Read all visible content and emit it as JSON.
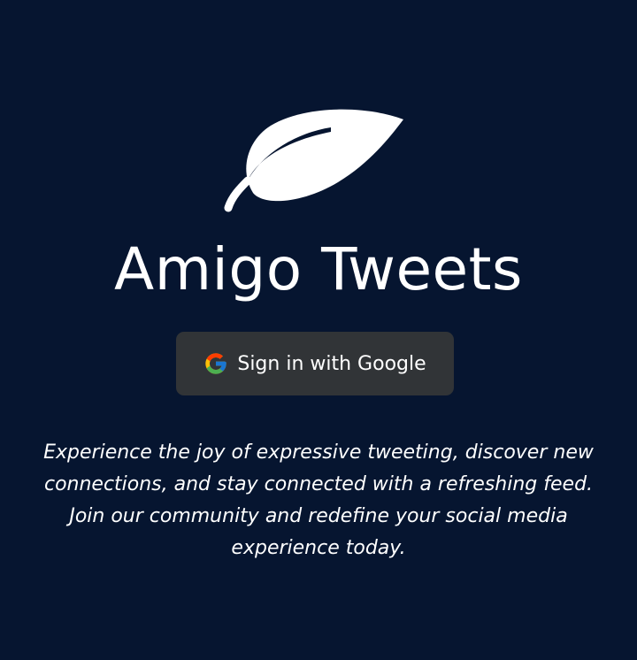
{
  "app": {
    "title": "Amigo Tweets",
    "logo_icon": "leaf-icon"
  },
  "signin": {
    "label": "Sign in with Google",
    "icon": "google-icon"
  },
  "tagline": "Experience the joy of expressive tweeting, discover new connections, and stay connected with a refreshing feed. Join our community and redefine your social media experience today.",
  "colors": {
    "background": "#061530",
    "button": "#313437",
    "text": "#ffffff"
  }
}
